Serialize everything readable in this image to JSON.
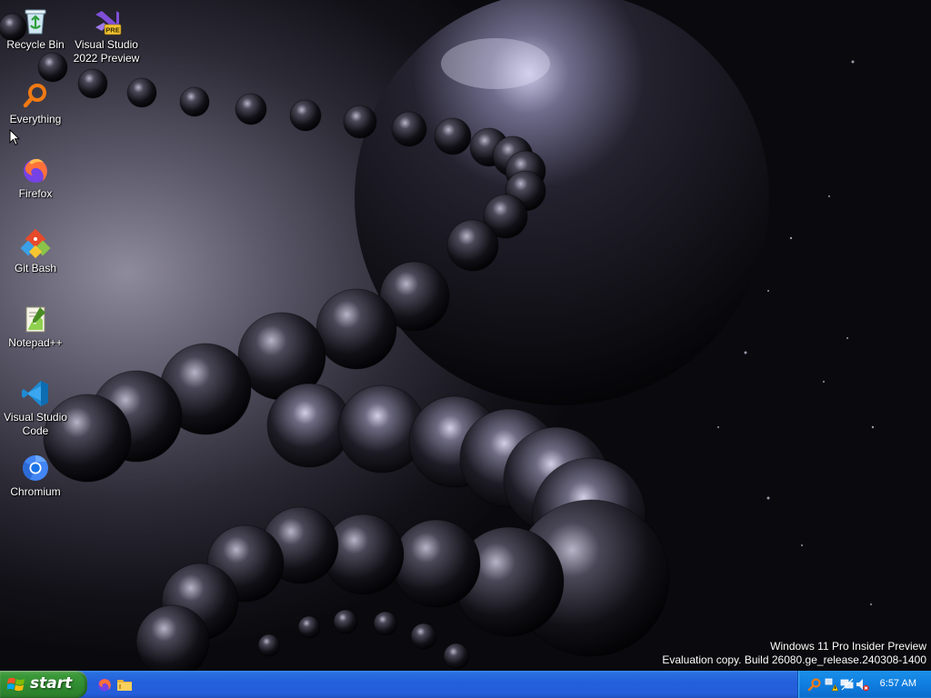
{
  "desktop": {
    "icons": [
      {
        "label": "Recycle Bin",
        "icon": "recycle-bin-icon"
      },
      {
        "label": "Visual Studio\n2022 Preview",
        "icon": "visual-studio-preview-icon",
        "badge": "PRE"
      },
      {
        "label": "Everything",
        "icon": "everything-search-icon"
      },
      {
        "label": "Firefox",
        "icon": "firefox-icon"
      },
      {
        "label": "Git Bash",
        "icon": "git-bash-icon"
      },
      {
        "label": "Notepad++",
        "icon": "notepad-plus-plus-icon"
      },
      {
        "label": "Visual Studio\nCode",
        "icon": "vscode-icon"
      },
      {
        "label": "Chromium",
        "icon": "chromium-icon"
      }
    ],
    "watermark": {
      "line1": "Windows 11 Pro Insider Preview",
      "line2": "Evaluation copy. Build 26080.ge_release.240308-1400"
    }
  },
  "taskbar": {
    "start_label": "start",
    "quick_launch": [
      "firefox-icon",
      "file-explorer-icon"
    ],
    "tray": {
      "icons": [
        "search-icon",
        "network-warning-icon",
        "network-disconnected-icon",
        "volume-muted-icon"
      ],
      "clock": "6:57 AM"
    }
  },
  "colors": {
    "taskbar_blue": "#245edb",
    "start_green": "#3c9a3a",
    "tray_blue": "#0f7ee0"
  }
}
